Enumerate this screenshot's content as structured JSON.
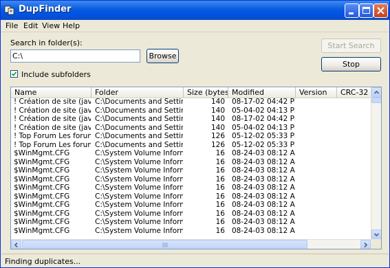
{
  "window": {
    "title": "DupFinder",
    "colors": {
      "titlebar": "#0054e3",
      "face": "#ece9d8",
      "list_bg": "#ffffff",
      "close_button": "#c8401c"
    }
  },
  "menu": [
    "File",
    "Edit",
    "View",
    "Help"
  ],
  "search": {
    "label": "Search in folder(s):",
    "value": "C:\\",
    "browse_label": "Browse"
  },
  "options": {
    "include_subfolders_label": "Include subfolders",
    "include_subfolders_checked": true
  },
  "actions": {
    "start_label": "Start Search",
    "start_enabled": false,
    "stop_label": "Stop"
  },
  "results": {
    "columns": [
      "Name",
      "Folder",
      "Size (bytes)",
      "Modified",
      "Version",
      "CRC-32"
    ],
    "rows": [
      {
        "name": "! Création de site (javas...",
        "folder": "C:\\Documents and Setting...",
        "size": "140",
        "modified": "08-17-02 04:42 PM"
      },
      {
        "name": "! Création de site (javas...",
        "folder": "C:\\Documents and Setting...",
        "size": "140",
        "modified": "05-04-02 04:13 PM"
      },
      {
        "name": "! Création de site (javas...",
        "folder": "C:\\Documents and Setting...",
        "size": "140",
        "modified": "08-17-02 04:42 PM"
      },
      {
        "name": "! Création de site (javas...",
        "folder": "C:\\Documents and Setting...",
        "size": "140",
        "modified": "05-04-02 04:13 PM"
      },
      {
        "name": "! Top Forum  Les forums...",
        "folder": "C:\\Documents and Setting...",
        "size": "126",
        "modified": "05-12-02 05:33 PM"
      },
      {
        "name": "! Top Forum  Les forums...",
        "folder": "C:\\Documents and Setting...",
        "size": "126",
        "modified": "05-12-02 05:33 PM"
      },
      {
        "name": "$WinMgmt.CFG",
        "folder": "C:\\System Volume Informat...",
        "size": "16",
        "modified": "08-24-03 08:12 AM"
      },
      {
        "name": "$WinMgmt.CFG",
        "folder": "C:\\System Volume Informat...",
        "size": "16",
        "modified": "08-24-03 08:12 AM"
      },
      {
        "name": "$WinMgmt.CFG",
        "folder": "C:\\System Volume Informat...",
        "size": "16",
        "modified": "08-24-03 08:12 AM"
      },
      {
        "name": "$WinMgmt.CFG",
        "folder": "C:\\System Volume Informat...",
        "size": "16",
        "modified": "08-24-03 08:12 AM"
      },
      {
        "name": "$WinMgmt.CFG",
        "folder": "C:\\System Volume Informat...",
        "size": "16",
        "modified": "08-24-03 08:12 AM"
      },
      {
        "name": "$WinMgmt.CFG",
        "folder": "C:\\System Volume Informat...",
        "size": "16",
        "modified": "08-24-03 08:12 AM"
      },
      {
        "name": "$WinMgmt.CFG",
        "folder": "C:\\System Volume Informat...",
        "size": "16",
        "modified": "08-24-03 08:12 AM"
      },
      {
        "name": "$WinMgmt.CFG",
        "folder": "C:\\System Volume Informat...",
        "size": "16",
        "modified": "08-24-03 08:12 AM"
      },
      {
        "name": "$WinMgmt.CFG",
        "folder": "C:\\System Volume Informat...",
        "size": "16",
        "modified": "08-24-03 08:12 AM"
      },
      {
        "name": "$WinMgmt.CFG",
        "folder": "C:\\System Volume Informat...",
        "size": "16",
        "modified": "08-24-03 08:12 AM"
      }
    ]
  },
  "status": "Finding duplicates..."
}
